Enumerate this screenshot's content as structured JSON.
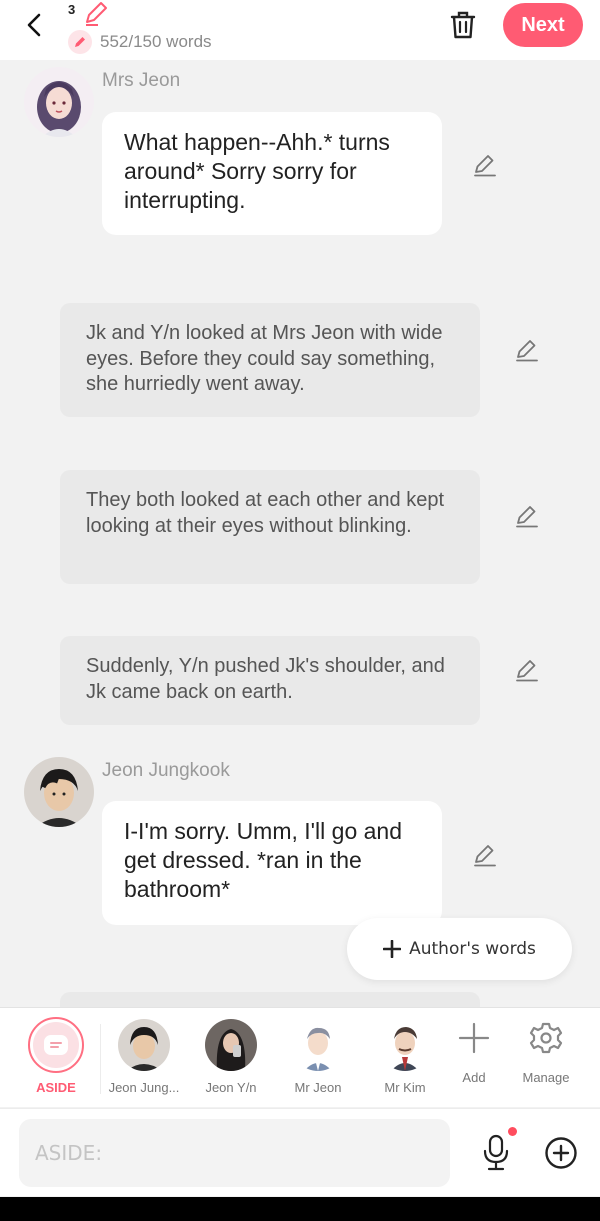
{
  "header": {
    "draft_number": "3",
    "word_count": "552/150 words",
    "next_label": "Next"
  },
  "messages": [
    {
      "type": "dialogue",
      "speaker": "Mrs Jeon",
      "text": "What happen--Ahh.* turns around* Sorry sorry for interrupting."
    },
    {
      "type": "narration",
      "text": "Jk and Y/n looked at Mrs Jeon with wide eyes. Before they could say something, she hurriedly went away."
    },
    {
      "type": "narration",
      "text": "They both looked at each other and kept looking at their eyes without blinking."
    },
    {
      "type": "narration",
      "text": "Suddenly, Y/n pushed Jk's shoulder, and Jk came back on earth."
    },
    {
      "type": "dialogue",
      "speaker": "Jeon Jungkook",
      "text": "I-I'm sorry. Umm, I'll go and get dressed. *ran in the bathroom*"
    }
  ],
  "author_words_label": "Author's words",
  "characters": [
    {
      "label": "ASIDE",
      "selected": true
    },
    {
      "label": "Jeon Jung..."
    },
    {
      "label": "Jeon Y/n"
    },
    {
      "label": "Mr Jeon"
    },
    {
      "label": "Mr Kim"
    },
    {
      "label": "Add"
    },
    {
      "label": "Manage"
    }
  ],
  "input": {
    "placeholder": "ASIDE:"
  },
  "colors": {
    "accent": "#ff5b73",
    "aside_label": "#ff5b73",
    "narration_bg": "#e9e9e9"
  }
}
